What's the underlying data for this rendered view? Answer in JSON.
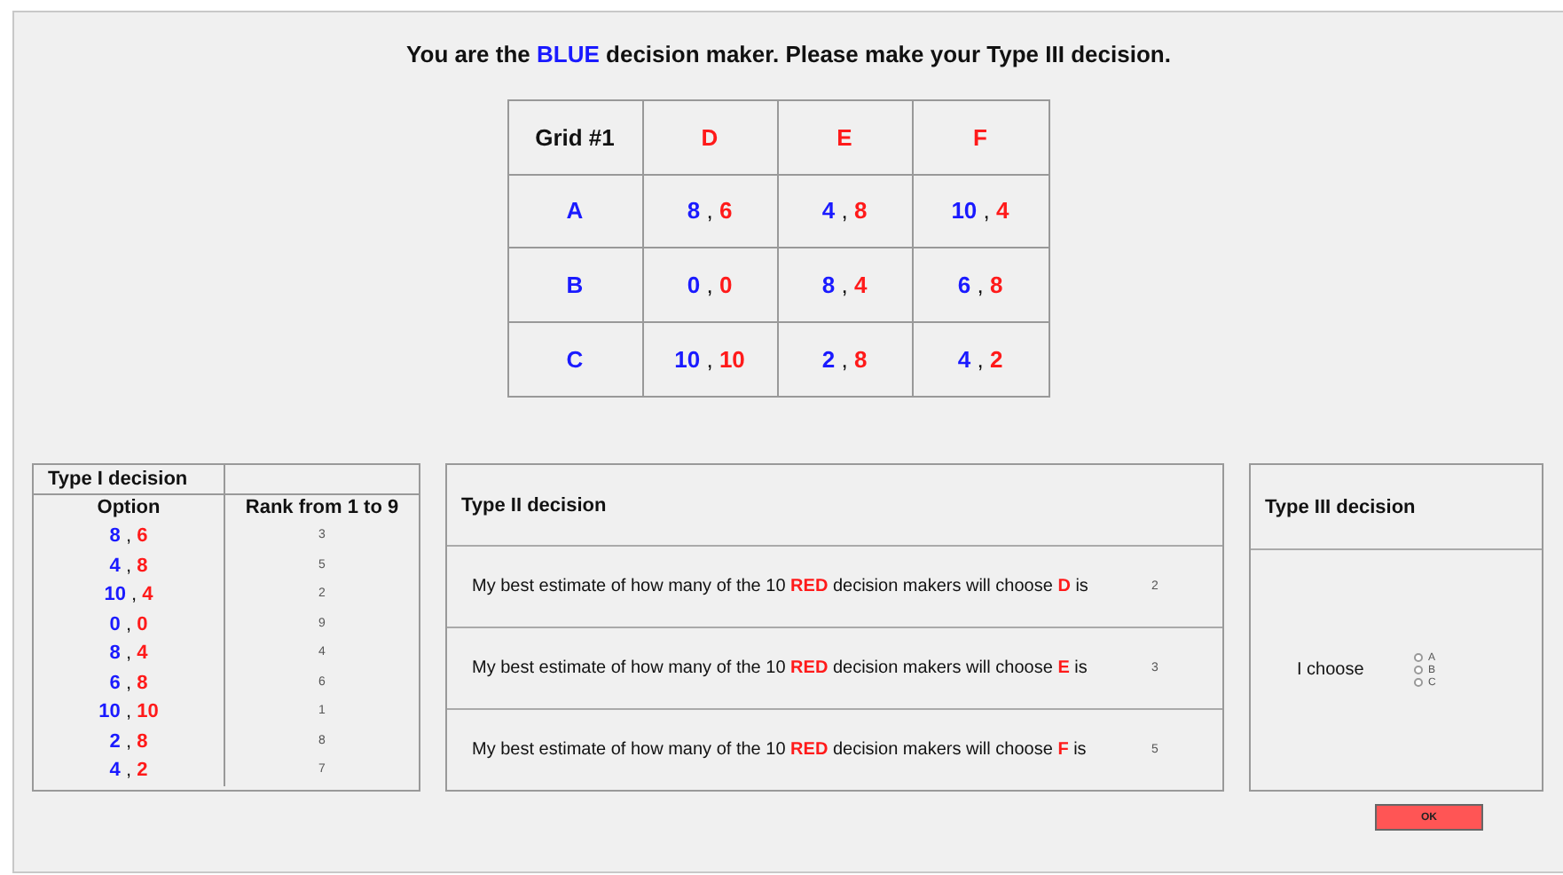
{
  "title": [
    {
      "kind": "plain",
      "text": "You are the"
    },
    {
      "kind": "blue",
      "text": "BLUE"
    },
    {
      "kind": "plain",
      "text": "decision maker. Please make your Type III decision."
    }
  ],
  "grid": {
    "corner": "Grid #1",
    "columns": [
      "D",
      "E",
      "F"
    ],
    "rows": [
      {
        "label": "A",
        "cells": [
          {
            "blue": "8",
            "sep": ",",
            "red": "6"
          },
          {
            "blue": "4",
            "sep": ",",
            "red": "8"
          },
          {
            "blue": "10",
            "sep": ",",
            "red": "4"
          }
        ]
      },
      {
        "label": "B",
        "cells": [
          {
            "blue": "0",
            "sep": ",",
            "red": "0"
          },
          {
            "blue": "8",
            "sep": ",",
            "red": "4"
          },
          {
            "blue": "6",
            "sep": ",",
            "red": "8"
          }
        ]
      },
      {
        "label": "C",
        "cells": [
          {
            "blue": "10",
            "sep": ",",
            "red": "10"
          },
          {
            "blue": "2",
            "sep": ",",
            "red": "8"
          },
          {
            "blue": "4",
            "sep": ",",
            "red": "2"
          }
        ]
      }
    ]
  },
  "type1": {
    "title": "Type I decision",
    "col_option": "Option",
    "col_rank": "Rank from 1 to 9",
    "rows": [
      {
        "option": {
          "blue": "8",
          "sep": ",",
          "red": "6"
        },
        "rank": "3"
      },
      {
        "option": {
          "blue": "4",
          "sep": ",",
          "red": "8"
        },
        "rank": "5"
      },
      {
        "option": {
          "blue": "10",
          "sep": ",",
          "red": "4"
        },
        "rank": "2"
      },
      {
        "option": {
          "blue": "0",
          "sep": ",",
          "red": "0"
        },
        "rank": "9"
      },
      {
        "option": {
          "blue": "8",
          "sep": ",",
          "red": "4"
        },
        "rank": "4"
      },
      {
        "option": {
          "blue": "6",
          "sep": ",",
          "red": "8"
        },
        "rank": "6"
      },
      {
        "option": {
          "blue": "10",
          "sep": ",",
          "red": "10"
        },
        "rank": "1"
      },
      {
        "option": {
          "blue": "2",
          "sep": ",",
          "red": "8"
        },
        "rank": "8"
      },
      {
        "option": {
          "blue": "4",
          "sep": ",",
          "red": "2"
        },
        "rank": "7"
      }
    ]
  },
  "type2": {
    "title": "Type II decision",
    "rows": [
      {
        "sentence": [
          {
            "kind": "plain",
            "text": "My best estimate of how many of the 10"
          },
          {
            "kind": "red",
            "text": "RED"
          },
          {
            "kind": "plain",
            "text": "decision makers will choose"
          },
          {
            "kind": "red",
            "text": "D"
          },
          {
            "kind": "plain",
            "text": "is"
          }
        ],
        "value": "2"
      },
      {
        "sentence": [
          {
            "kind": "plain",
            "text": "My best estimate of how many of the 10"
          },
          {
            "kind": "red",
            "text": "RED"
          },
          {
            "kind": "plain",
            "text": "decision makers will choose"
          },
          {
            "kind": "red",
            "text": "E"
          },
          {
            "kind": "plain",
            "text": "is"
          }
        ],
        "value": "3"
      },
      {
        "sentence": [
          {
            "kind": "plain",
            "text": "My best estimate of how many of the 10"
          },
          {
            "kind": "red",
            "text": "RED"
          },
          {
            "kind": "plain",
            "text": "decision makers will choose"
          },
          {
            "kind": "red",
            "text": "F"
          },
          {
            "kind": "plain",
            "text": "is"
          }
        ],
        "value": "5"
      }
    ]
  },
  "type3": {
    "title": "Type III decision",
    "label": "I choose",
    "options": [
      {
        "label": "A",
        "selected": false
      },
      {
        "label": "B",
        "selected": false
      },
      {
        "label": "C",
        "selected": false
      }
    ]
  },
  "ok_button": "OK"
}
